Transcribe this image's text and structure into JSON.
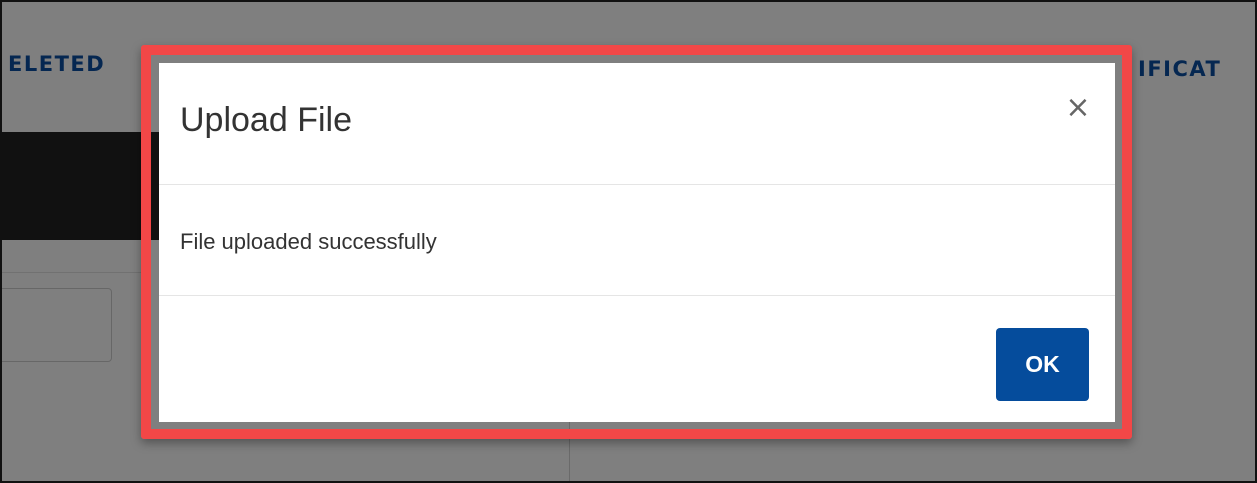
{
  "background": {
    "tab_left_label": "ELETED",
    "tab_right_label": "IFICAT"
  },
  "dialog": {
    "title": "Upload File",
    "close_label": "×",
    "message": "File uploaded successfully",
    "ok_label": "OK"
  },
  "colors": {
    "highlight_border": "#f24747",
    "ok_button": "#054c9c",
    "tab_text": "#0b4ea2"
  },
  "icons": {
    "close": "close-icon"
  }
}
